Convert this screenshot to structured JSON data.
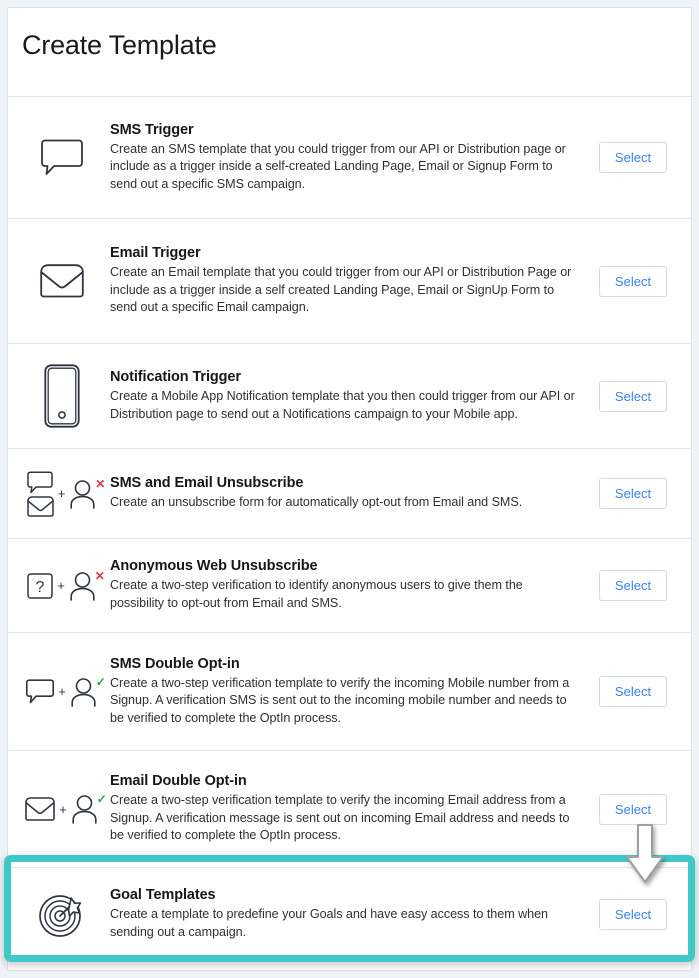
{
  "header": {
    "title": "Create Template"
  },
  "colors": {
    "accent_blue": "#3b82f6",
    "highlight_teal": "#3fc8c8",
    "mark_red": "#e4344b",
    "mark_green": "#28a745",
    "icon_stroke": "#2f3640",
    "page_background": "#eff2f6",
    "card_background": "#ffffff",
    "divider": "#e4e7ea"
  },
  "select_label": "Select",
  "plus_label": "+",
  "templates": [
    {
      "id": "sms-trigger",
      "title": "SMS Trigger",
      "description": "Create an SMS template that you could trigger from our API or Distribution page or include as a trigger inside a self-created Landing Page, Email or Signup Form to send out a specific SMS campaign.",
      "icon": "chat-bubble-icon",
      "button": "Select"
    },
    {
      "id": "email-trigger",
      "title": "Email Trigger",
      "description": "Create an Email template that you could trigger from our API or Distribution Page or include as a trigger inside a self created Landing Page, Email or SignUp Form to send out a specific Email campaign.",
      "icon": "envelope-icon",
      "button": "Select"
    },
    {
      "id": "notification-trigger",
      "title": "Notification Trigger",
      "description": "Create a Mobile App Notification template that you then could trigger from our API or Distribution page to send out a Notifications campaign to your Mobile app.",
      "icon": "mobile-phone-icon",
      "button": "Select"
    },
    {
      "id": "sms-and-email-unsubscribe",
      "title": "SMS and Email Unsubscribe",
      "description": "Create an unsubscribe form for automatically opt-out from Email and SMS.",
      "icon": "chat-envelope-plus-user-remove-icon",
      "button": "Select"
    },
    {
      "id": "anonymous-web-unsubscribe",
      "title": "Anonymous Web Unsubscribe",
      "description": "Create a two-step verification to identify anonymous users to give them the possibility to opt-out from Email and SMS.",
      "icon": "question-plus-user-remove-icon",
      "button": "Select"
    },
    {
      "id": "sms-double-opt-in",
      "title": "SMS Double Opt-in",
      "description": "Create a two-step verification template to verify the incoming Mobile number from a Signup. A verification SMS is sent out to the incoming mobile number and needs to be verified to complete the OptIn process.",
      "icon": "chat-plus-user-verified-icon",
      "button": "Select"
    },
    {
      "id": "email-double-opt-in",
      "title": "Email Double Opt-in",
      "description": "Create a two-step verification template to verify the incoming Email address from a Signup. A verification message is sent out on incoming Email address and needs to be verified to complete the OptIn process.",
      "icon": "envelope-plus-user-verified-icon",
      "button": "Select"
    },
    {
      "id": "goal-templates",
      "title": "Goal Templates",
      "description": "Create a template to predefine your Goals and have easy access to them when sending out a campaign.",
      "icon": "target-dart-icon",
      "button": "Select",
      "highlighted": true
    }
  ]
}
